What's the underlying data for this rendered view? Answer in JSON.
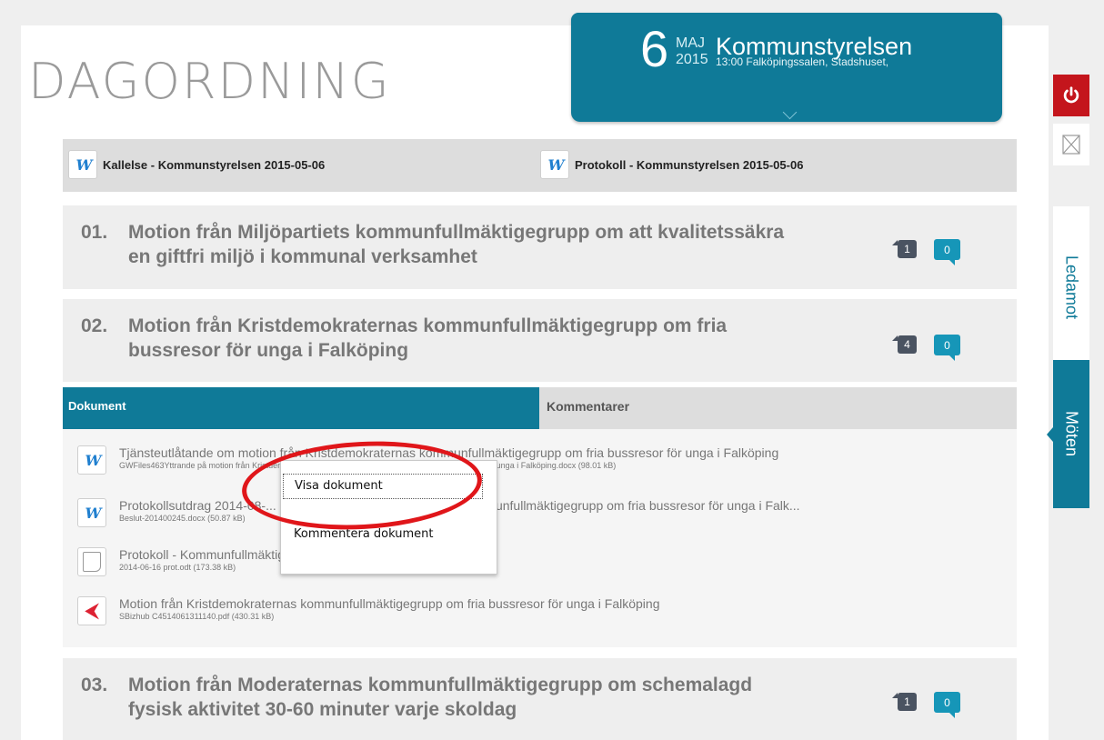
{
  "header": {
    "title": "DAGORDNING",
    "meeting": {
      "day": "6",
      "month": "MAJ",
      "year": "2015",
      "body": "Kommunstyrelsen",
      "details": "13:00 Falköpingssalen, Stadshuset,"
    }
  },
  "sidebar": {
    "tabs": [
      "Ledamot",
      "Möten"
    ]
  },
  "documents_bar": {
    "items": [
      {
        "label": "Kallelse - Kommunstyrelsen 2015-05-06",
        "icon": "word-icon"
      },
      {
        "label": "Protokoll - Kommunstyrelsen 2015-05-06",
        "icon": "word-icon"
      }
    ]
  },
  "agenda": [
    {
      "num": "01.",
      "line1": "Motion från Miljöpartiets kommunfullmäktigegrupp om att kvalitetssäkra",
      "line2": "en giftfri miljö i kommunal verksamhet",
      "docs": "1",
      "comments": "0"
    },
    {
      "num": "02.",
      "line1": "Motion från Kristdemokraternas kommunfullmäktigegrupp om fria",
      "line2": "bussresor för unga i Falköping",
      "docs": "4",
      "comments": "0"
    },
    {
      "num": "03.",
      "line1": "Motion från Moderaternas kommunfullmäktigegrupp om schemalagd",
      "line2": "fysisk aktivitet 30-60 minuter varje skoldag",
      "docs": "1",
      "comments": "0"
    }
  ],
  "detail_tabs": {
    "documents": "Dokument",
    "comments": "Kommentarer"
  },
  "document_list": [
    {
      "name": "Tjänsteutlåtande om motion från Kristdemokraternas kommunfullmäktigegrupp om fria bussresor för unga i Falköping",
      "meta": "GWFiles463Yttrande på motion från Kristdemokraternas kommunfullmäktigegrupp om fria bussresor för unga i Falköping.docx (98.01 kB)",
      "icon": "word-icon"
    },
    {
      "name": "Protokollsutdrag 2014-08-... Motion från Kristdemokraternas kommunfullmäktigegrupp om fria bussresor för unga i Falk...",
      "meta": "Beslut-201400245.docx (50.87 kB)",
      "icon": "word-icon"
    },
    {
      "name": "Protokoll - Kommunfullmäktige 2014-06-16",
      "meta": "2014-06-16 prot.odt (173.38 kB)",
      "icon": "note-icon"
    },
    {
      "name": "Motion från Kristdemokraternas kommunfullmäktigegrupp om fria bussresor för unga i Falköping",
      "meta": "SBizhub C4514061311140.pdf (430.31 kB)",
      "icon": "pdf-icon"
    }
  ],
  "context_menu": {
    "items": [
      "Visa dokument",
      "Kommentera dokument"
    ]
  },
  "colors": {
    "accent": "#0f7a98",
    "power": "#c4151c",
    "annotation": "#e0161a"
  }
}
